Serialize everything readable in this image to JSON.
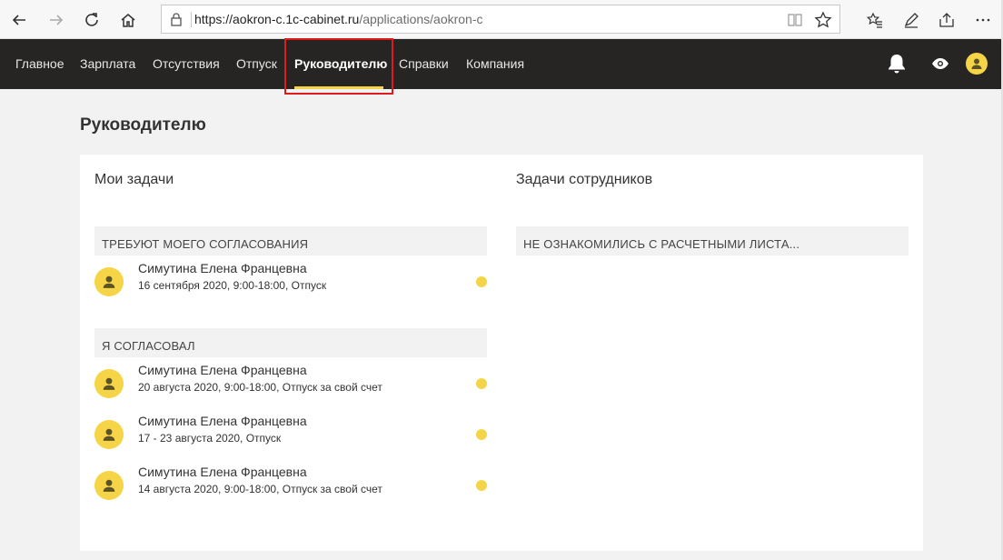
{
  "browser": {
    "url_host": "https://aokron-c.1c-cabinet.ru",
    "url_path": "/applications/aokron-c"
  },
  "nav": {
    "items": [
      "Главное",
      "Зарплата",
      "Отсутствия",
      "Отпуск",
      "Руководителю",
      "Справки",
      "Компания"
    ],
    "active_index": 4
  },
  "page": {
    "title": "Руководителю"
  },
  "my_tasks": {
    "title": "Мои задачи",
    "pending": {
      "header": "ТРЕБУЮТ МОЕГО СОГЛАСОВАНИЯ",
      "items": [
        {
          "name": "Симутина Елена Францевна",
          "detail": "16 сентября 2020, 9:00-18:00, Отпуск"
        }
      ]
    },
    "approved": {
      "header": "Я СОГЛАСОВАЛ",
      "items": [
        {
          "name": "Симутина Елена Францевна",
          "detail": "20 августа 2020, 9:00-18:00, Отпуск за свой счет"
        },
        {
          "name": "Симутина Елена Францевна",
          "detail": "17 - 23 августа 2020, Отпуск"
        },
        {
          "name": "Симутина Елена Францевна",
          "detail": "14 августа 2020, 9:00-18:00, Отпуск за свой счет"
        }
      ]
    }
  },
  "employee_tasks": {
    "title": "Задачи сотрудников",
    "group_header": "НЕ ОЗНАКОМИЛИСЬ С РАСЧЕТНЫМИ ЛИСТА..."
  },
  "colors": {
    "accent": "#f5d547",
    "nav_bg": "#262524",
    "highlight": "#e01b1b"
  },
  "icons": [
    "back-icon",
    "forward-icon",
    "refresh-icon",
    "home-icon",
    "lock-icon",
    "reading-view-icon",
    "favorite-star-icon",
    "favorites-list-icon",
    "pen-icon",
    "share-icon",
    "more-icon",
    "bell-icon",
    "eye-icon",
    "user-icon"
  ]
}
